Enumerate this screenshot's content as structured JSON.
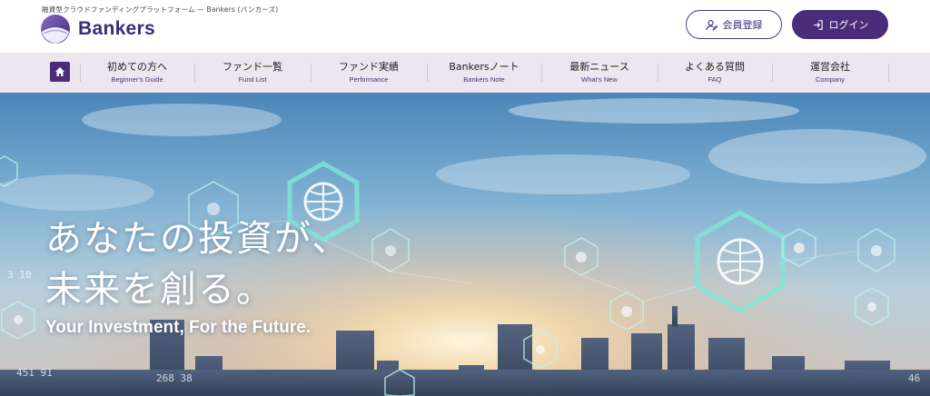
{
  "header": {
    "tagline": "融資型クラウドファンディングプラットフォーム — Bankers (バンカーズ)",
    "logo_text": "Bankers",
    "register_label": "会員登録",
    "login_label": "ログイン",
    "brand_color": "#4a2c7a"
  },
  "nav": {
    "home_icon": "home-icon",
    "items": [
      {
        "jp": "初めての方へ",
        "en": "Beginner's Guide"
      },
      {
        "jp": "ファンド一覧",
        "en": "Fund List"
      },
      {
        "jp": "ファンド実績",
        "en": "Performance"
      },
      {
        "jp": "Bankersノート",
        "en": "Bankers Note"
      },
      {
        "jp": "最新ニュース",
        "en": "What's New"
      },
      {
        "jp": "よくある質問",
        "en": "FAQ"
      },
      {
        "jp": "運営会社",
        "en": "Company"
      }
    ]
  },
  "hero": {
    "title_line1": "あなたの投資が、",
    "title_line2": "未来を創る。",
    "subtitle": "Your Investment, For the Future.",
    "numbers": [
      "451 91",
      "268 38",
      "3 10",
      "46"
    ]
  }
}
